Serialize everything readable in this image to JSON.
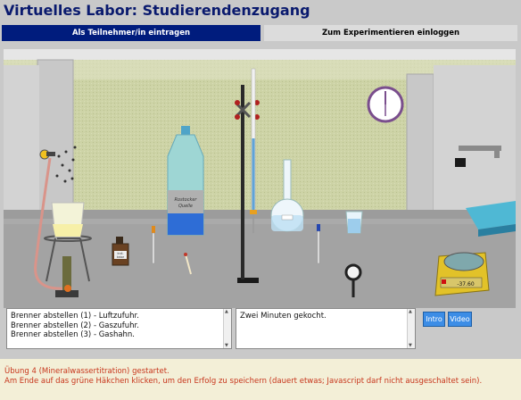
{
  "page": {
    "title": "Virtuelles Labor: Studierendenzugang"
  },
  "tabs": [
    {
      "label": "Als Teilnehmer/in eintragen",
      "active": true
    },
    {
      "label": "Zum Experimentieren einloggen",
      "active": false
    }
  ],
  "lab": {
    "bottle_label": [
      "Rostocker",
      "Quelle"
    ],
    "reagent_label": [
      "Indi-",
      "kator"
    ],
    "scale_display": "-37.60"
  },
  "log": {
    "lines": [
      "Brenner abstellen (1) - Luftzufuhr.",
      "Brenner abstellen (2) - Gaszufuhr.",
      "Brenner abstellen (3) - Gashahn."
    ]
  },
  "message": {
    "text": "Zwei Minuten gekocht."
  },
  "buttons": {
    "intro": "Intro",
    "video": "Video"
  },
  "status": {
    "line1": "Übung 4 (Mineralwassertitration) gestartet.",
    "line2": "Am Ende auf das grüne Häkchen klicken, um den Erfolg zu speichern (dauert etwas; Javascript darf nicht ausgeschaltet sein)."
  },
  "colors": {
    "tab_active": "#001c7d",
    "title": "#0a1a6e",
    "button": "#3c8de6",
    "status_text": "#c7361c",
    "wall_green": "#c9cf9e"
  }
}
